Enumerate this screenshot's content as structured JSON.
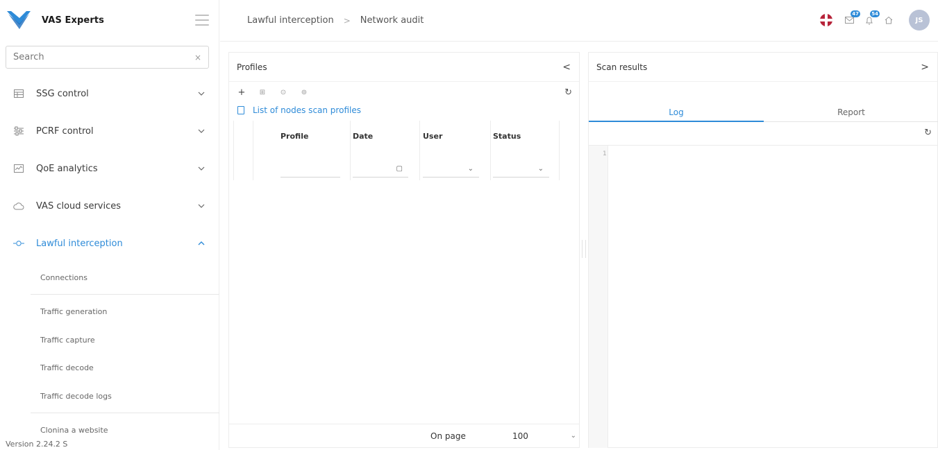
{
  "brand": {
    "name": "VAS Experts",
    "accent": "#2e8bd8"
  },
  "search": {
    "placeholder": "Search",
    "clear": "×"
  },
  "nav": {
    "items": [
      {
        "label": "SSG control",
        "icon": "table-icon"
      },
      {
        "label": "PCRF control",
        "icon": "sliders-icon"
      },
      {
        "label": "QoE analytics",
        "icon": "chart-icon"
      },
      {
        "label": "VAS cloud services",
        "icon": "cloud-icon"
      },
      {
        "label": "Lawful interception",
        "icon": "node-icon",
        "active": true
      }
    ],
    "sub_items": [
      "Connections",
      "Traffic generation",
      "Traffic capture",
      "Traffic decode",
      "Traffic decode logs",
      "Clonina a website"
    ]
  },
  "version": "Version 2.24.2 S",
  "header": {
    "breadcrumb": [
      "Lawful interception",
      "Network audit"
    ],
    "separator": ">",
    "badges": {
      "mail": "47",
      "bell": "54"
    },
    "avatar_initials": "JS"
  },
  "profiles": {
    "title": "Profiles",
    "collapse": "<",
    "tree_node": "List of nodes scan profiles",
    "columns": [
      "Profile",
      "Date",
      "User",
      "Status"
    ],
    "on_page_label": "On page",
    "page_size": "100"
  },
  "scan": {
    "title": "Scan results",
    "expand": ">",
    "tabs": [
      "Log",
      "Report"
    ],
    "line_number": "1"
  }
}
